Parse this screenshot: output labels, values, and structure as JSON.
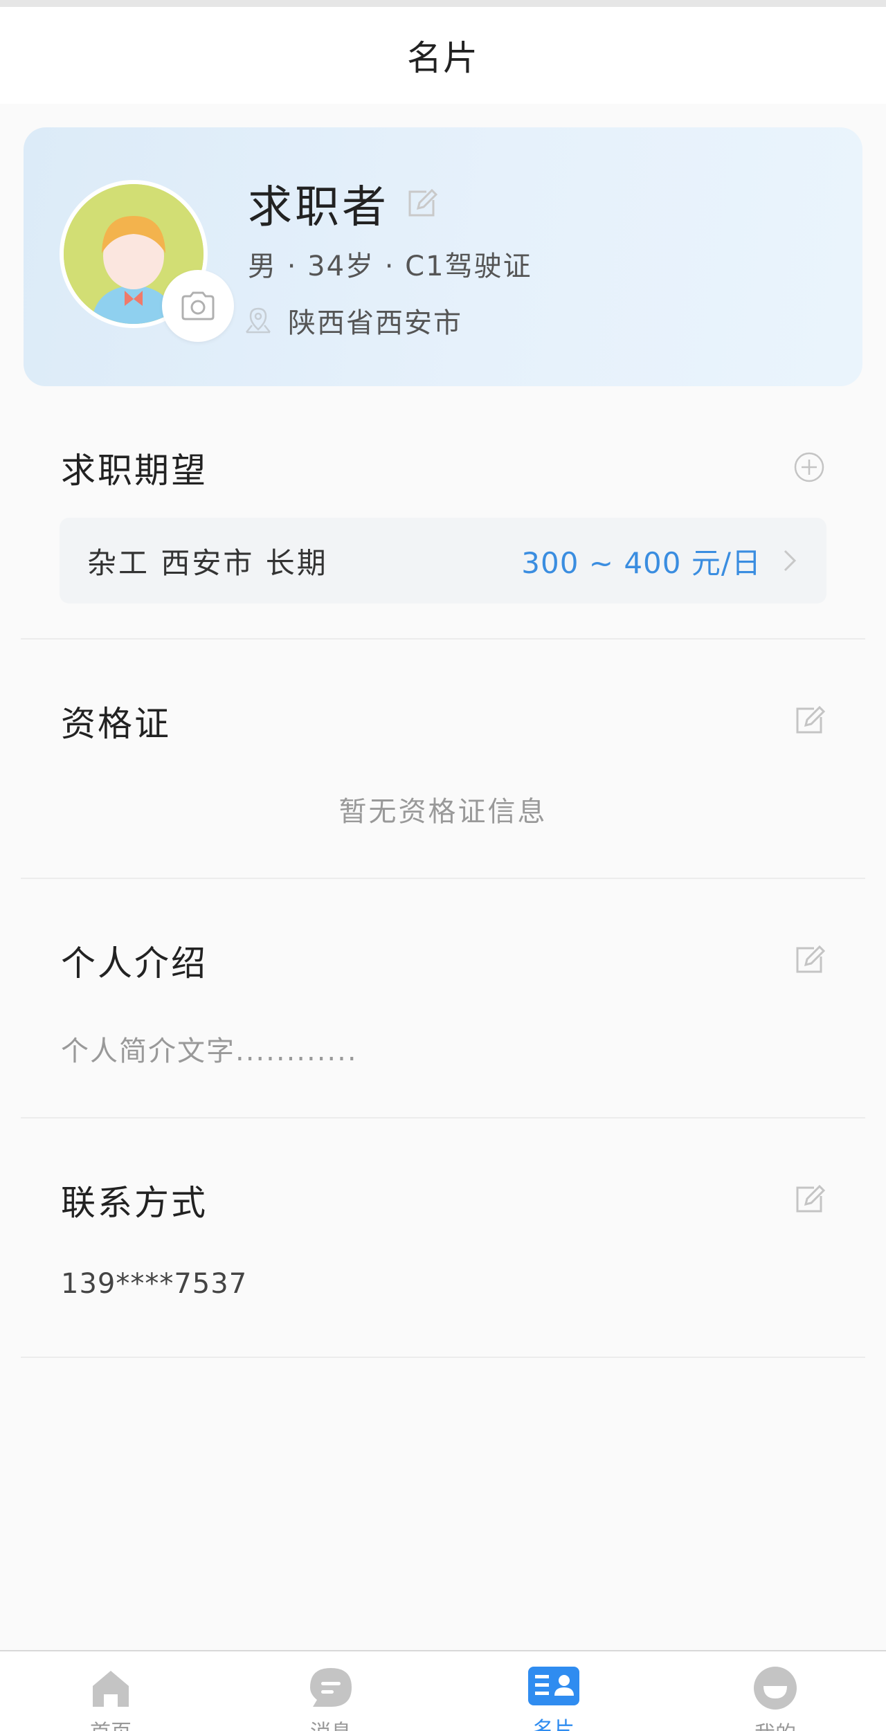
{
  "header": {
    "title": "名片"
  },
  "profile": {
    "name": "求职者",
    "info": "男 · 34岁 · C1驾驶证",
    "location": "陕西省西安市"
  },
  "sections": {
    "expectation": {
      "title": "求职期望",
      "item_text": "杂工  西安市  长期",
      "salary": "300 ~ 400 元/日"
    },
    "certificate": {
      "title": "资格证",
      "empty_text": "暂无资格证信息"
    },
    "intro": {
      "title": "个人介绍",
      "text": "个人简介文字............"
    },
    "contact": {
      "title": "联系方式",
      "phone": "139****7537"
    }
  },
  "tabbar": {
    "items": [
      {
        "label": "首页",
        "icon": "home-icon"
      },
      {
        "label": "消息",
        "icon": "message-icon"
      },
      {
        "label": "名片",
        "icon": "card-icon",
        "active": true
      },
      {
        "label": "我的",
        "icon": "profile-icon"
      }
    ]
  },
  "colors": {
    "accent": "#2f8cf0",
    "salary": "#3a8de0",
    "card_bg": "#e3eff9"
  }
}
